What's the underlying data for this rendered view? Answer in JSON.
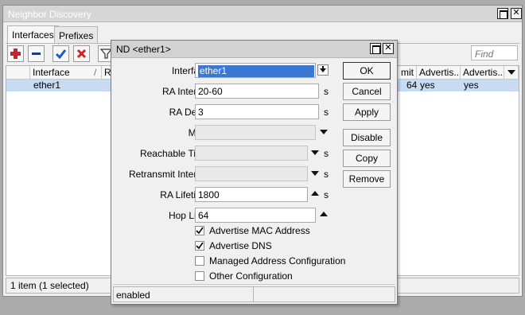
{
  "outer": {
    "title": "Neighbor Discovery",
    "tabs": [
      "Interfaces",
      "Prefixes"
    ],
    "find_placeholder": "Find",
    "columns": [
      "Interface",
      "RA",
      "mit",
      "Advertis...",
      "Advertis..."
    ],
    "row": {
      "interface": "ether1",
      "mit": "64",
      "adv1": "yes",
      "adv2": "yes"
    },
    "status": "1 item (1 selected)"
  },
  "dialog": {
    "title": "ND <ether1>",
    "fields": {
      "interface": {
        "label": "Interface:",
        "value": "ether1"
      },
      "ra_interval": {
        "label": "RA Interval:",
        "value": "20-60",
        "unit": "s"
      },
      "ra_delay": {
        "label": "RA Delay:",
        "value": "3",
        "unit": "s"
      },
      "mtu": {
        "label": "MTU:",
        "value": ""
      },
      "reachable_time": {
        "label": "Reachable Time:",
        "value": "",
        "unit": "s"
      },
      "retransmit_interval": {
        "label": "Retransmit Interval:",
        "value": "",
        "unit": "s"
      },
      "ra_lifetime": {
        "label": "RA Lifetime:",
        "value": "1800",
        "unit": "s"
      },
      "hop_limit": {
        "label": "Hop Limit:",
        "value": "64"
      }
    },
    "checkboxes": [
      {
        "label": "Advertise MAC Address",
        "checked": true
      },
      {
        "label": "Advertise DNS",
        "checked": true
      },
      {
        "label": "Managed Address Configuration",
        "checked": false
      },
      {
        "label": "Other Configuration",
        "checked": false
      }
    ],
    "buttons": {
      "ok": "OK",
      "cancel": "Cancel",
      "apply": "Apply",
      "disable": "Disable",
      "copy": "Copy",
      "remove": "Remove"
    },
    "status": "enabled"
  },
  "colors": {
    "add": "#d42020",
    "remove": "#1a3a8a",
    "check": "#1a5ad6",
    "cross": "#d42020",
    "selection": "#c7dcf3",
    "interface_highlight": "#3a78d4"
  }
}
